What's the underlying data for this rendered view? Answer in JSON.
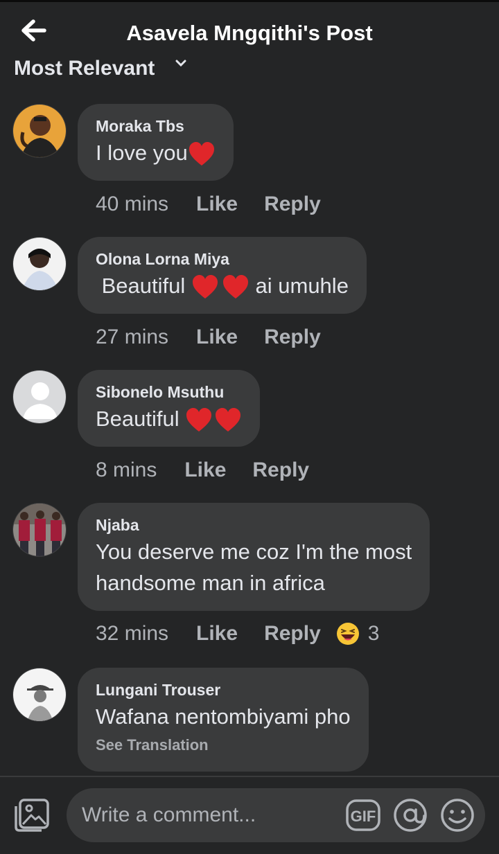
{
  "header": {
    "title": "Asavela Mngqithi's Post",
    "sort_label": "Most Relevant"
  },
  "comments": [
    {
      "author": "Moraka Tbs",
      "text": "I love you",
      "emoji": [
        "red-heart"
      ],
      "time": "40 mins",
      "like_label": "Like",
      "reply_label": "Reply"
    },
    {
      "author": "Olona Lorna Miya",
      "text_before": " Beautiful",
      "text_after": "ai umuhle",
      "emoji": [
        "red-heart",
        "red-heart"
      ],
      "time": "27 mins",
      "like_label": "Like",
      "reply_label": "Reply"
    },
    {
      "author": "Sibonelo Msuthu",
      "text": "Beautiful",
      "emoji": [
        "red-heart",
        "red-heart"
      ],
      "time": "8 mins",
      "like_label": "Like",
      "reply_label": "Reply"
    },
    {
      "author": "Njaba",
      "text_line1": "You deserve me coz I'm the most",
      "text_line2": "handsome man in africa",
      "time": "32 mins",
      "like_label": "Like",
      "reply_label": "Reply",
      "reaction": {
        "icon": "laughing-emoji",
        "count": "3"
      }
    },
    {
      "author": "Lungani Trouser",
      "text": "Wafana nentombiyami pho",
      "see_translation": "See Translation"
    }
  ],
  "composer": {
    "placeholder": "Write a comment...",
    "gif_label": "GIF"
  },
  "colors": {
    "background": "#242526",
    "bubble": "#3a3b3c",
    "primary_text": "#e4e6eb",
    "secondary_text": "#b0b3b8",
    "heart": "#e0262a"
  }
}
